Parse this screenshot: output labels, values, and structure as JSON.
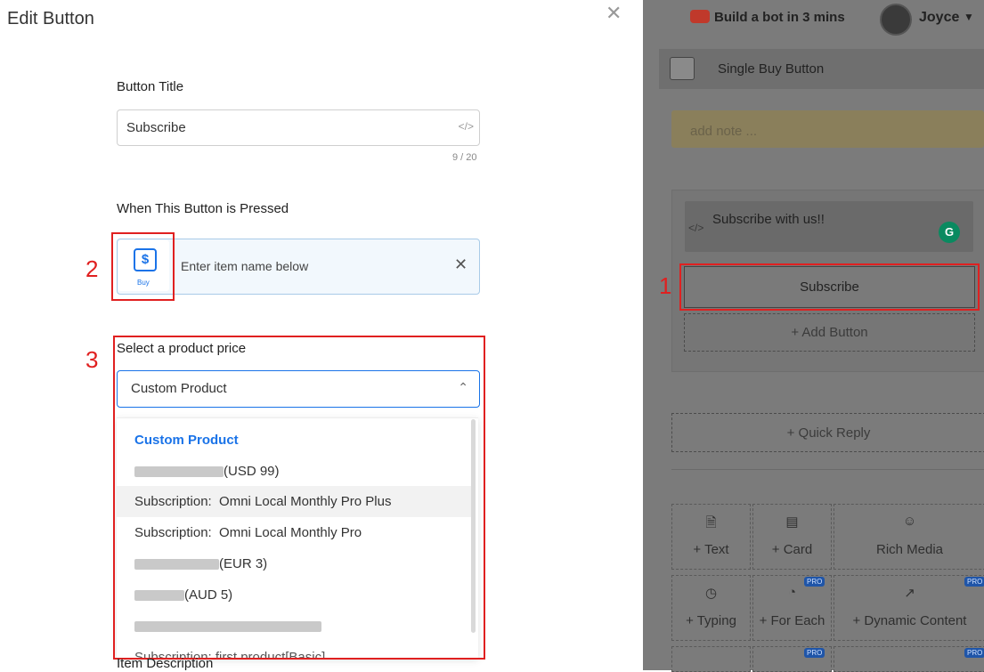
{
  "modal": {
    "title": "Edit Button",
    "close_icon": "close-icon",
    "button_title_label": "Button Title",
    "button_title_value": "Subscribe",
    "button_title_counter": "9 / 20",
    "when_pressed_label": "When This Button is Pressed",
    "action": {
      "tile_label": "Buy",
      "text": "Enter item name below"
    },
    "product_price_label": "Select a product price",
    "product_price_selected": "Custom Product",
    "options": [
      {
        "text": "Custom Product",
        "selected": true
      },
      {
        "text": "(USD 99)",
        "blurred": true
      },
      {
        "text": "Subscription:  Omni Local Monthly Pro Plus",
        "highlighted": true
      },
      {
        "text": "Subscription:  Omni Local Monthly Pro"
      },
      {
        "text": "(EUR 3)",
        "blurred": true
      },
      {
        "text": "(AUD 5)",
        "blurred": true
      },
      {
        "text": "",
        "blurred": true
      },
      {
        "text": "Subscription: first product[Basic]"
      }
    ],
    "item_description_label": "Item Description",
    "annotations": [
      "1",
      "2",
      "3"
    ]
  },
  "right_panel": {
    "promo": "Build a bot in 3 mins",
    "user": "Joyce",
    "node_title": "Single Buy Button",
    "note_placeholder": "add note ...",
    "message": "Subscribe with us!!",
    "button_label": "Subscribe",
    "add_button": "+ Add Button",
    "quick_reply": "+ Quick Reply",
    "tiles": [
      {
        "label": "+ Text",
        "icon": "document-icon"
      },
      {
        "label": "+ Card",
        "icon": "card-icon"
      },
      {
        "label": "Rich Media",
        "icon": "smiley-icon"
      },
      {
        "label": "+ Typing",
        "icon": "clock-icon"
      },
      {
        "label": "+ For Each",
        "icon": "pie-icon",
        "pro": true
      },
      {
        "label": "+ Dynamic Content",
        "icon": "external-link-icon",
        "pro": true
      }
    ],
    "pro_badge": "PRO"
  },
  "colors": {
    "accent": "#1a73e8",
    "annotation": "#e02020",
    "overlay": "#7b7b7b"
  }
}
